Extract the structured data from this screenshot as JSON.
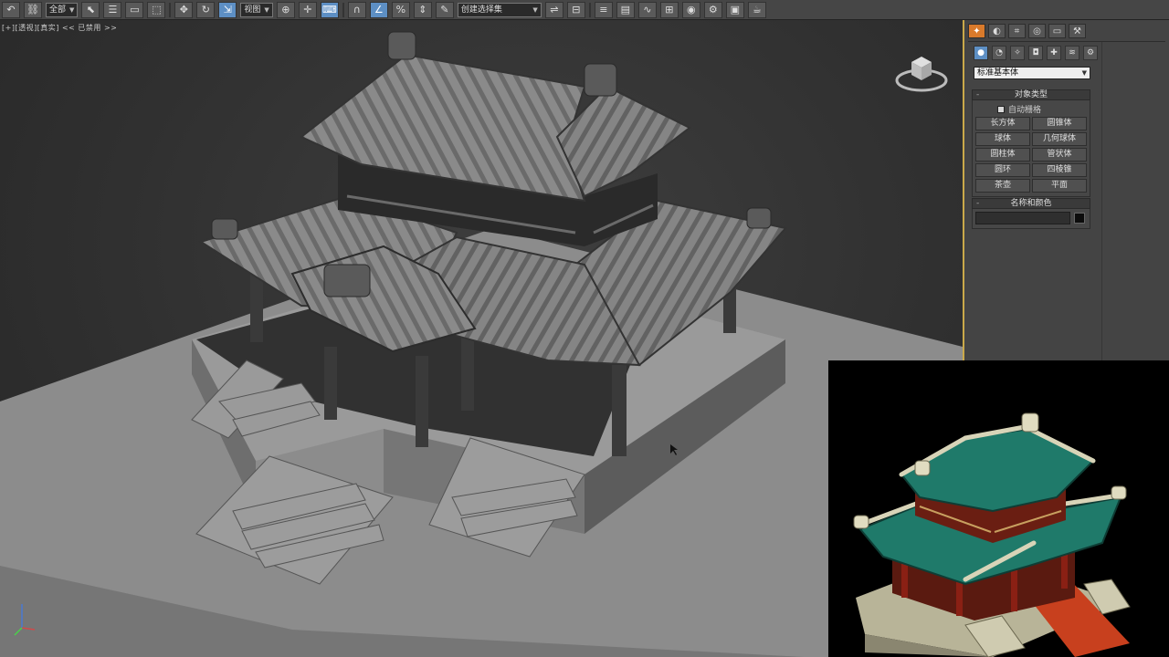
{
  "toolbar": {
    "selection_filter": "全部",
    "reference_coord": "视图",
    "named_selection": "创建选择集",
    "buttons": [
      "undo-icon",
      "link-icon",
      "select-object-icon",
      "select-region-icon",
      "window-crossing-icon",
      "move-icon",
      "rotate-icon",
      "scale-icon",
      "pivot-icon",
      "select-manipulate-icon",
      "snap-icon",
      "angle-snap-icon",
      "percent-snap-icon",
      "spinner-snap-icon",
      "edit-named-selection-icon",
      "mirror-icon",
      "align-icon",
      "layer-icon",
      "graphite-icon",
      "curve-editor-icon",
      "schematic-icon",
      "material-editor-icon",
      "render-setup-icon",
      "rendered-frame-icon",
      "render-icon"
    ]
  },
  "viewport": {
    "label": "[+][透视][真实]  << 已禁用 >>"
  },
  "command_panel": {
    "tabs": [
      "create-tab",
      "modify-tab",
      "hierarchy-tab",
      "motion-tab",
      "display-tab",
      "utilities-tab"
    ],
    "categories": [
      "geometry-icon",
      "shapes-icon",
      "lights-icon",
      "cameras-icon",
      "helpers-icon",
      "spacewarps-icon",
      "systems-icon"
    ],
    "subcategory": "标准基本体",
    "object_type": {
      "title": "对象类型",
      "autogrid_label": "自动栅格",
      "buttons": [
        "长方体",
        "圆锥体",
        "球体",
        "几何球体",
        "圆柱体",
        "管状体",
        "圆环",
        "四棱锥",
        "茶壶",
        "平面"
      ]
    },
    "name_color": {
      "title": "名称和颜色",
      "name_value": "",
      "color": "#0c0c0c"
    }
  },
  "reference_image": {
    "roof_color": "#1f7a6a",
    "pillar_color": "#7a1f12",
    "carpet_color": "#c8401e",
    "stone_color": "#b8b498"
  },
  "colors": {
    "panel_accent": "#caa94a",
    "active_tab": "#d97a2b",
    "active_button": "#5d8fc4"
  }
}
